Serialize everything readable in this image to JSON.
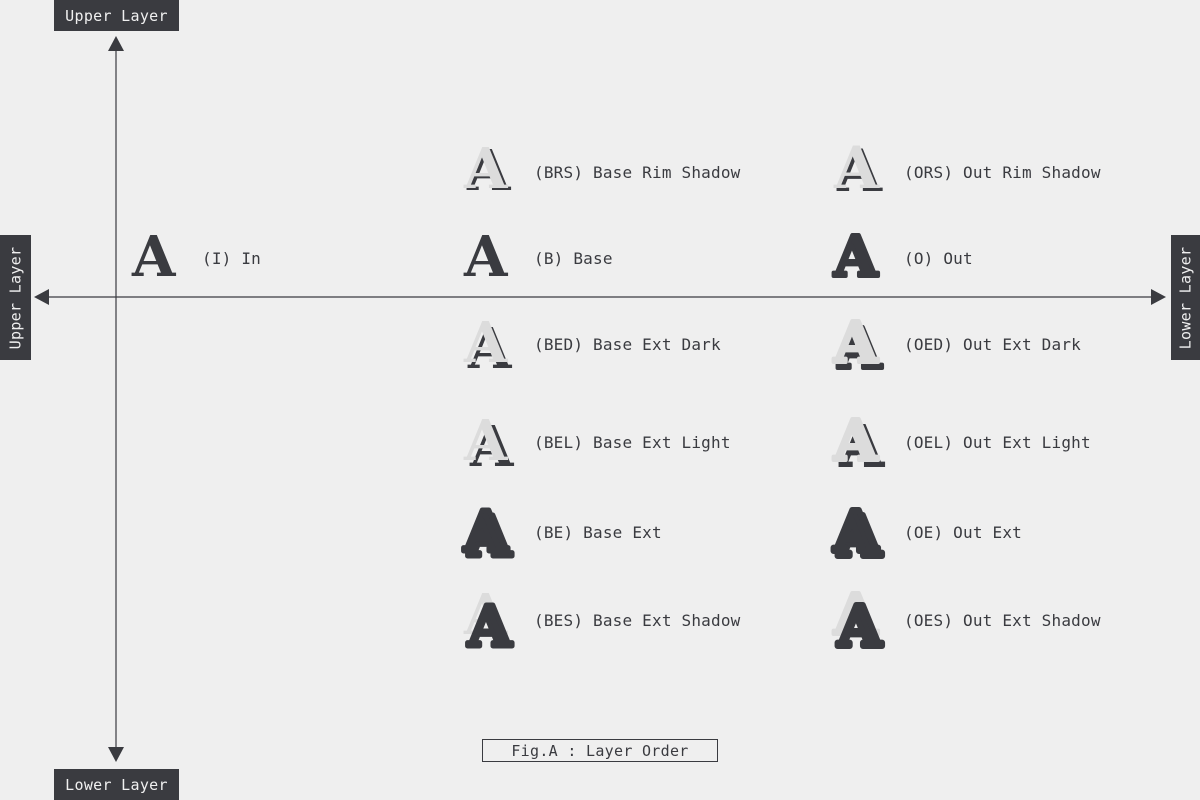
{
  "axes": {
    "top": "Upper Layer",
    "bottom": "Lower Layer",
    "left": "Upper Layer",
    "right": "Lower Layer"
  },
  "colors": {
    "dark": "#3a3b40",
    "light": "#dcdcdc",
    "background": "#efefef"
  },
  "items": {
    "in": "(I) In",
    "brs": "(BRS) Base Rim Shadow",
    "ors": "(ORS) Out Rim Shadow",
    "b": "(B) Base",
    "o": "(O) Out",
    "bed": "(BED) Base Ext Dark",
    "oed": "(OED) Out Ext Dark",
    "bel": "(BEL) Base Ext Light",
    "oel": "(OEL) Out Ext Light",
    "be": "(BE) Base Ext",
    "oe": "(OE) Out Ext",
    "bes": "(BES) Base Ext Shadow",
    "oes": "(OES) Out Ext Shadow"
  },
  "caption": "Fig.A : Layer Order",
  "glyph_letter": "A"
}
